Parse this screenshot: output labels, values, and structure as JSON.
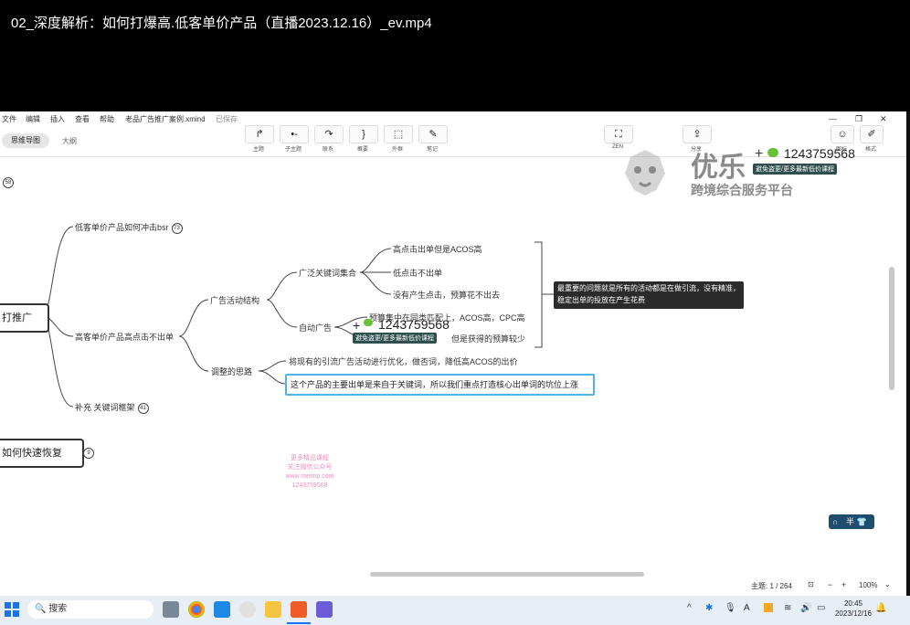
{
  "player": {
    "title": "02_深度解析：如何打爆高.低客单价产品（直播2023.12.16）_ev.mp4"
  },
  "menu": {
    "items": [
      "文件",
      "编辑",
      "插入",
      "查看",
      "帮助"
    ],
    "doc_title": "老品广告推广案例.xmind",
    "save_status": "已保存"
  },
  "view_tabs": {
    "mindmap": "思维导图",
    "outline": "大纲"
  },
  "toolbar": {
    "buttons": [
      {
        "label": "主题",
        "icon": "↱"
      },
      {
        "label": "子主题",
        "icon": "•-"
      },
      {
        "label": "联系",
        "icon": "↷"
      },
      {
        "label": "概要",
        "icon": "}"
      },
      {
        "label": "外框",
        "icon": "⬚"
      },
      {
        "label": "笔记",
        "icon": "✎"
      }
    ],
    "zen_label": "ZEN",
    "share_label": "分享",
    "right_labels": [
      "图标",
      "格式"
    ]
  },
  "mindmap": {
    "top_badge": "58",
    "partial_root": "打推广",
    "branch1": {
      "text": "低客单价产品如何冲击bsr",
      "badge": "73"
    },
    "branch2": {
      "text": "高客单价产品高点击不出单"
    },
    "branch3": {
      "text": "补充 关键词框架",
      "badge": "41"
    },
    "ad_structure": "广告活动结构",
    "broad_set": "广泛关键词集合",
    "broad_children": [
      "高点击出单但是ACOS高",
      "低点击不出单",
      "没有产生点击，预算花不出去"
    ],
    "auto_ad": "自动广告",
    "auto_children": [
      "预算集中在同类匹配上，ACOS高，CPC高",
      "但是获得的预算较少"
    ],
    "callout": "最重要的问题就是所有的活动都是在做引流，没有精准，稳定出单的投放在产生花费",
    "adjust": "调整的思路",
    "adjust_children": [
      "将现有的引流广告活动进行优化，做否词，降低高ACOS的出价",
      "这个产品的主要出单是来自于关键词，所以我们重点打造核心出单词的坑位上涨"
    ],
    "recover_node": "如何快速恢复",
    "recover_badge": "9"
  },
  "watermark": {
    "brand": "优乐",
    "subtitle": "跨境综合服务平台",
    "phone": "1243759568",
    "tag": "避免盗更/更多最新低价课程",
    "pink_lines": [
      "更多精品课程",
      "关注微信公众号",
      "www.meimp.com",
      "1243759568"
    ]
  },
  "status_bar": {
    "topic_count": "主题: 1 / 264",
    "zoom": "100%"
  },
  "ime": {
    "mode": "半"
  },
  "taskbar": {
    "search": "搜索",
    "time": "20:45",
    "date": "2023/12/16",
    "lang": "A"
  }
}
